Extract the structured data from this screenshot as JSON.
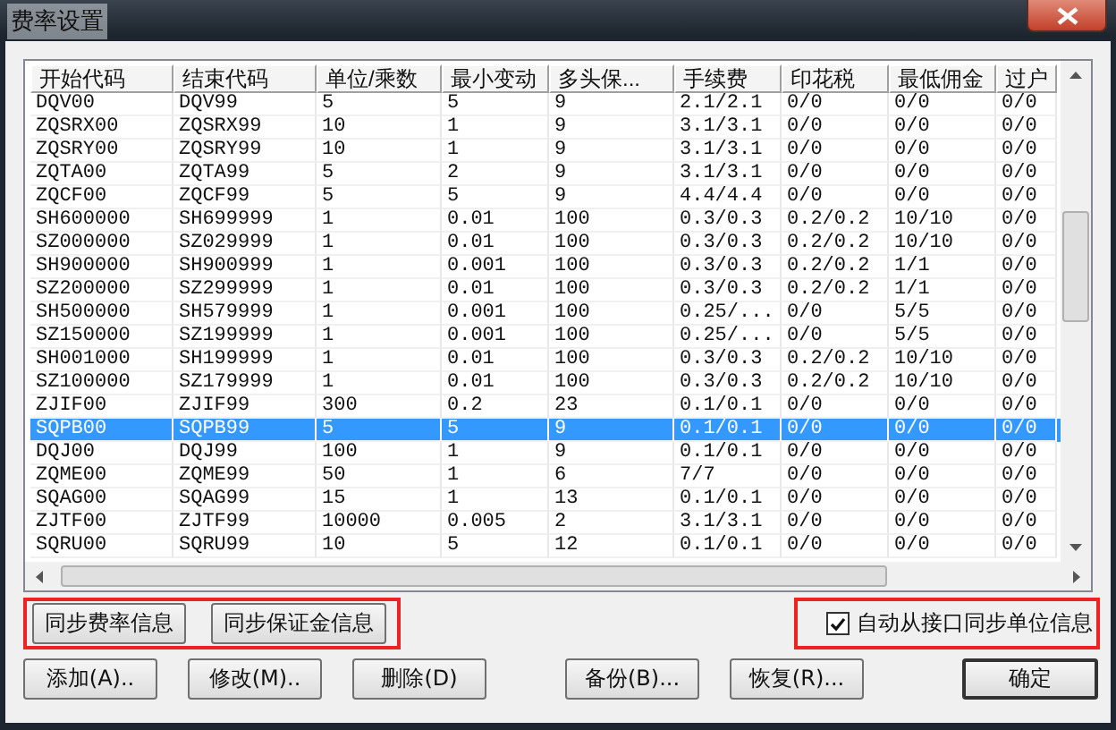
{
  "window": {
    "title": "费率设置"
  },
  "table": {
    "columns": [
      "开始代码",
      "结束代码",
      "单位/乘数",
      "最小变动",
      "多头保...",
      "手续费",
      "印花税",
      "最低佣金",
      "过户"
    ],
    "rows": [
      {
        "cells": [
          "DQV00",
          "DQV99",
          "5",
          "5",
          "9",
          "2.1/2.1",
          "0/0",
          "0/0",
          "0/0"
        ],
        "selected": false
      },
      {
        "cells": [
          "ZQSRX00",
          "ZQSRX99",
          "10",
          "1",
          "9",
          "3.1/3.1",
          "0/0",
          "0/0",
          "0/0"
        ],
        "selected": false
      },
      {
        "cells": [
          "ZQSRY00",
          "ZQSRY99",
          "10",
          "1",
          "9",
          "3.1/3.1",
          "0/0",
          "0/0",
          "0/0"
        ],
        "selected": false
      },
      {
        "cells": [
          "ZQTA00",
          "ZQTA99",
          "5",
          "2",
          "9",
          "3.1/3.1",
          "0/0",
          "0/0",
          "0/0"
        ],
        "selected": false
      },
      {
        "cells": [
          "ZQCF00",
          "ZQCF99",
          "5",
          "5",
          "9",
          "4.4/4.4",
          "0/0",
          "0/0",
          "0/0"
        ],
        "selected": false
      },
      {
        "cells": [
          "SH600000",
          "SH699999",
          "1",
          "0.01",
          "100",
          "0.3/0.3",
          "0.2/0.2",
          "10/10",
          "0/0"
        ],
        "selected": false
      },
      {
        "cells": [
          "SZ000000",
          "SZ029999",
          "1",
          "0.01",
          "100",
          "0.3/0.3",
          "0.2/0.2",
          "10/10",
          "0/0"
        ],
        "selected": false
      },
      {
        "cells": [
          "SH900000",
          "SH900999",
          "1",
          "0.001",
          "100",
          "0.3/0.3",
          "0.2/0.2",
          "1/1",
          "0/0"
        ],
        "selected": false
      },
      {
        "cells": [
          "SZ200000",
          "SZ299999",
          "1",
          "0.01",
          "100",
          "0.3/0.3",
          "0.2/0.2",
          "1/1",
          "0/0"
        ],
        "selected": false
      },
      {
        "cells": [
          "SH500000",
          "SH579999",
          "1",
          "0.001",
          "100",
          "0.25/...",
          "0/0",
          "5/5",
          "0/0"
        ],
        "selected": false
      },
      {
        "cells": [
          "SZ150000",
          "SZ199999",
          "1",
          "0.001",
          "100",
          "0.25/...",
          "0/0",
          "5/5",
          "0/0"
        ],
        "selected": false
      },
      {
        "cells": [
          "SH001000",
          "SH199999",
          "1",
          "0.01",
          "100",
          "0.3/0.3",
          "0.2/0.2",
          "10/10",
          "0/0"
        ],
        "selected": false
      },
      {
        "cells": [
          "SZ100000",
          "SZ179999",
          "1",
          "0.01",
          "100",
          "0.3/0.3",
          "0.2/0.2",
          "10/10",
          "0/0"
        ],
        "selected": false
      },
      {
        "cells": [
          "ZJIF00",
          "ZJIF99",
          "300",
          "0.2",
          "23",
          "0.1/0.1",
          "0/0",
          "0/0",
          "0/0"
        ],
        "selected": false
      },
      {
        "cells": [
          "SQPB00",
          "SQPB99",
          "5",
          "5",
          "9",
          "0.1/0.1",
          "0/0",
          "0/0",
          "0/0"
        ],
        "selected": true
      },
      {
        "cells": [
          "DQJ00",
          "DQJ99",
          "100",
          "1",
          "9",
          "0.1/0.1",
          "0/0",
          "0/0",
          "0/0"
        ],
        "selected": false
      },
      {
        "cells": [
          "ZQME00",
          "ZQME99",
          "50",
          "1",
          "6",
          "7/7",
          "0/0",
          "0/0",
          "0/0"
        ],
        "selected": false
      },
      {
        "cells": [
          "SQAG00",
          "SQAG99",
          "15",
          "1",
          "13",
          "0.1/0.1",
          "0/0",
          "0/0",
          "0/0"
        ],
        "selected": false
      },
      {
        "cells": [
          "ZJTF00",
          "ZJTF99",
          "10000",
          "0.005",
          "2",
          "3.1/3.1",
          "0/0",
          "0/0",
          "0/0"
        ],
        "selected": false
      },
      {
        "cells": [
          "SQRU00",
          "SQRU99",
          "10",
          "5",
          "12",
          "0.1/0.1",
          "0/0",
          "0/0",
          "0/0"
        ],
        "selected": false
      }
    ]
  },
  "sync_buttons": [
    "同步费率信息",
    "同步保证金信息"
  ],
  "auto_sync": {
    "label": "自动从接口同步单位信息",
    "checked": true
  },
  "action_buttons": [
    "添加(A)..",
    "修改(M)..",
    "删除(D)",
    "备份(B)...",
    "恢复(R)..."
  ],
  "ok_button": "确定"
}
